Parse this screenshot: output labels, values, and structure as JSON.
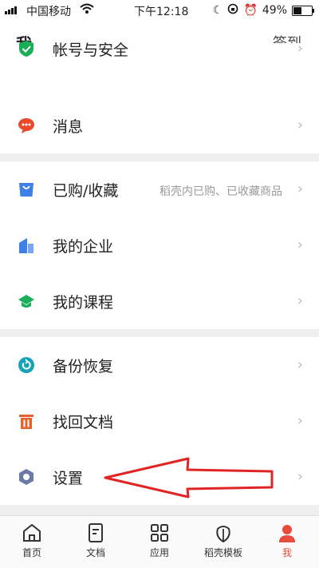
{
  "status": {
    "carrier": "中国移动",
    "time": "下午12:18",
    "battery": "49%",
    "battery_level": 0.49
  },
  "header": {
    "title": "我",
    "action": "签到"
  },
  "rows": [
    {
      "label": "帐号与安全",
      "hint": ""
    },
    {
      "label": "消息",
      "hint": ""
    },
    {
      "label": "已购/收藏",
      "hint": "稻壳内已购、已收藏商品"
    },
    {
      "label": "我的企业",
      "hint": ""
    },
    {
      "label": "我的课程",
      "hint": ""
    },
    {
      "label": "备份恢复",
      "hint": ""
    },
    {
      "label": "找回文档",
      "hint": ""
    },
    {
      "label": "设置",
      "hint": ""
    }
  ],
  "tabs": [
    {
      "label": "首页"
    },
    {
      "label": "文档"
    },
    {
      "label": "应用"
    },
    {
      "label": "稻壳模板"
    },
    {
      "label": "我"
    }
  ],
  "colors": {
    "accent": "#e74c3c",
    "shield": "#1aad5a",
    "message": "#e84a2c",
    "bag": "#3f7fe8",
    "company": "#3f7fe8",
    "course": "#1aad5a",
    "backup": "#16a3b8",
    "recover": "#e8632c",
    "settings": "#6c7aa8",
    "annotation_arrow": "#e02424"
  },
  "icons": {
    "shield": "shield-check-icon",
    "message": "speech-bubble-icon",
    "bag": "shopping-bag-icon",
    "company": "building-icon",
    "course": "graduation-cap-icon",
    "backup": "refresh-circle-icon",
    "recover": "trash-icon",
    "settings": "hexagon-gear-icon",
    "chevron": "chevron-right-icon"
  }
}
